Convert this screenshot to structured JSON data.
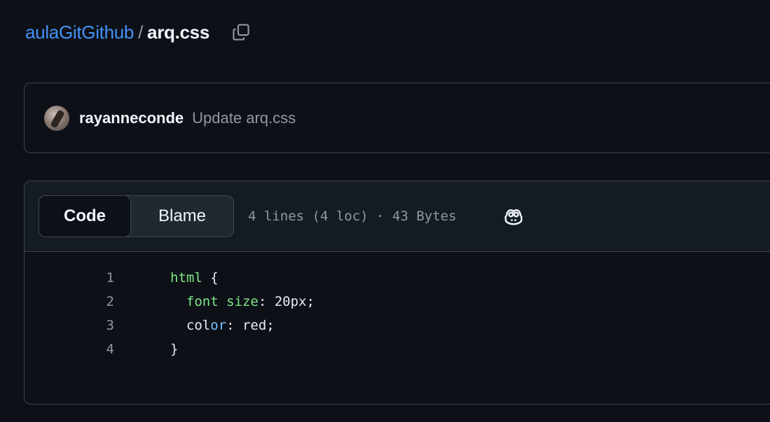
{
  "breadcrumb": {
    "repo": "aulaGitGithub",
    "separator": "/",
    "file": "arq.css",
    "copy_icon": "copy-icon"
  },
  "commit": {
    "author": "rayanneconde",
    "message": "Update arq.css",
    "avatar_icon": "avatar"
  },
  "file_viewer": {
    "tabs": [
      {
        "label": "Code",
        "active": true
      },
      {
        "label": "Blame",
        "active": false
      }
    ],
    "meta": "4 lines (4 loc) · 43 Bytes",
    "copilot_icon": "copilot-icon",
    "lines": [
      {
        "number": "1",
        "tokens": [
          {
            "t": "html",
            "c": "tag"
          },
          {
            "t": " {",
            "c": "plain"
          }
        ]
      },
      {
        "number": "2",
        "tokens": [
          {
            "t": "  font size",
            "c": "tag"
          },
          {
            "t": ": 20px;",
            "c": "plain"
          }
        ]
      },
      {
        "number": "3",
        "tokens": [
          {
            "t": "  col",
            "c": "plain"
          },
          {
            "t": "or",
            "c": "prop"
          },
          {
            "t": ": red;",
            "c": "plain"
          }
        ]
      },
      {
        "number": "4",
        "tokens": [
          {
            "t": "}",
            "c": "plain"
          }
        ]
      }
    ]
  },
  "colors": {
    "background": "#0d1117",
    "link": "#4493f8",
    "border": "#3d444d",
    "muted": "#9198a1",
    "code_tag": "#7ee787",
    "code_prop": "#79c0ff"
  }
}
